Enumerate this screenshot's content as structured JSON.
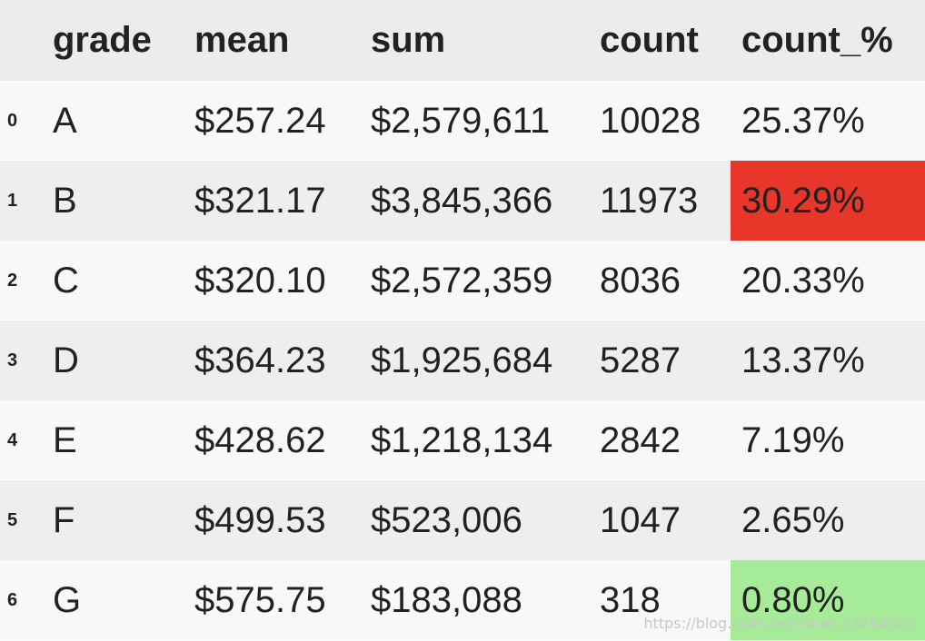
{
  "table": {
    "columns": [
      "grade",
      "mean",
      "sum",
      "count",
      "count_%"
    ],
    "rows": [
      {
        "index": "0",
        "grade": "A",
        "mean": "$257.24",
        "sum": "$2,579,611",
        "count": "10028",
        "count_pct": "25.37%",
        "highlight": ""
      },
      {
        "index": "1",
        "grade": "B",
        "mean": "$321.17",
        "sum": "$3,845,366",
        "count": "11973",
        "count_pct": "30.29%",
        "highlight": "max"
      },
      {
        "index": "2",
        "grade": "C",
        "mean": "$320.10",
        "sum": "$2,572,359",
        "count": "8036",
        "count_pct": "20.33%",
        "highlight": ""
      },
      {
        "index": "3",
        "grade": "D",
        "mean": "$364.23",
        "sum": "$1,925,684",
        "count": "5287",
        "count_pct": "13.37%",
        "highlight": ""
      },
      {
        "index": "4",
        "grade": "E",
        "mean": "$428.62",
        "sum": "$1,218,134",
        "count": "2842",
        "count_pct": "7.19%",
        "highlight": ""
      },
      {
        "index": "5",
        "grade": "F",
        "mean": "$499.53",
        "sum": "$523,006",
        "count": "1047",
        "count_pct": "2.65%",
        "highlight": ""
      },
      {
        "index": "6",
        "grade": "G",
        "mean": "$575.75",
        "sum": "$183,088",
        "count": "318",
        "count_pct": "0.80%",
        "highlight": "min"
      }
    ]
  },
  "colors": {
    "max_highlight": "#e8362a",
    "min_highlight": "#a6eb98",
    "header_bg": "#ececec",
    "row_light": "#f8f8f8",
    "row_dark": "#eeeeee"
  },
  "watermark": "https://blog.csdn.net/sinat_33264502"
}
